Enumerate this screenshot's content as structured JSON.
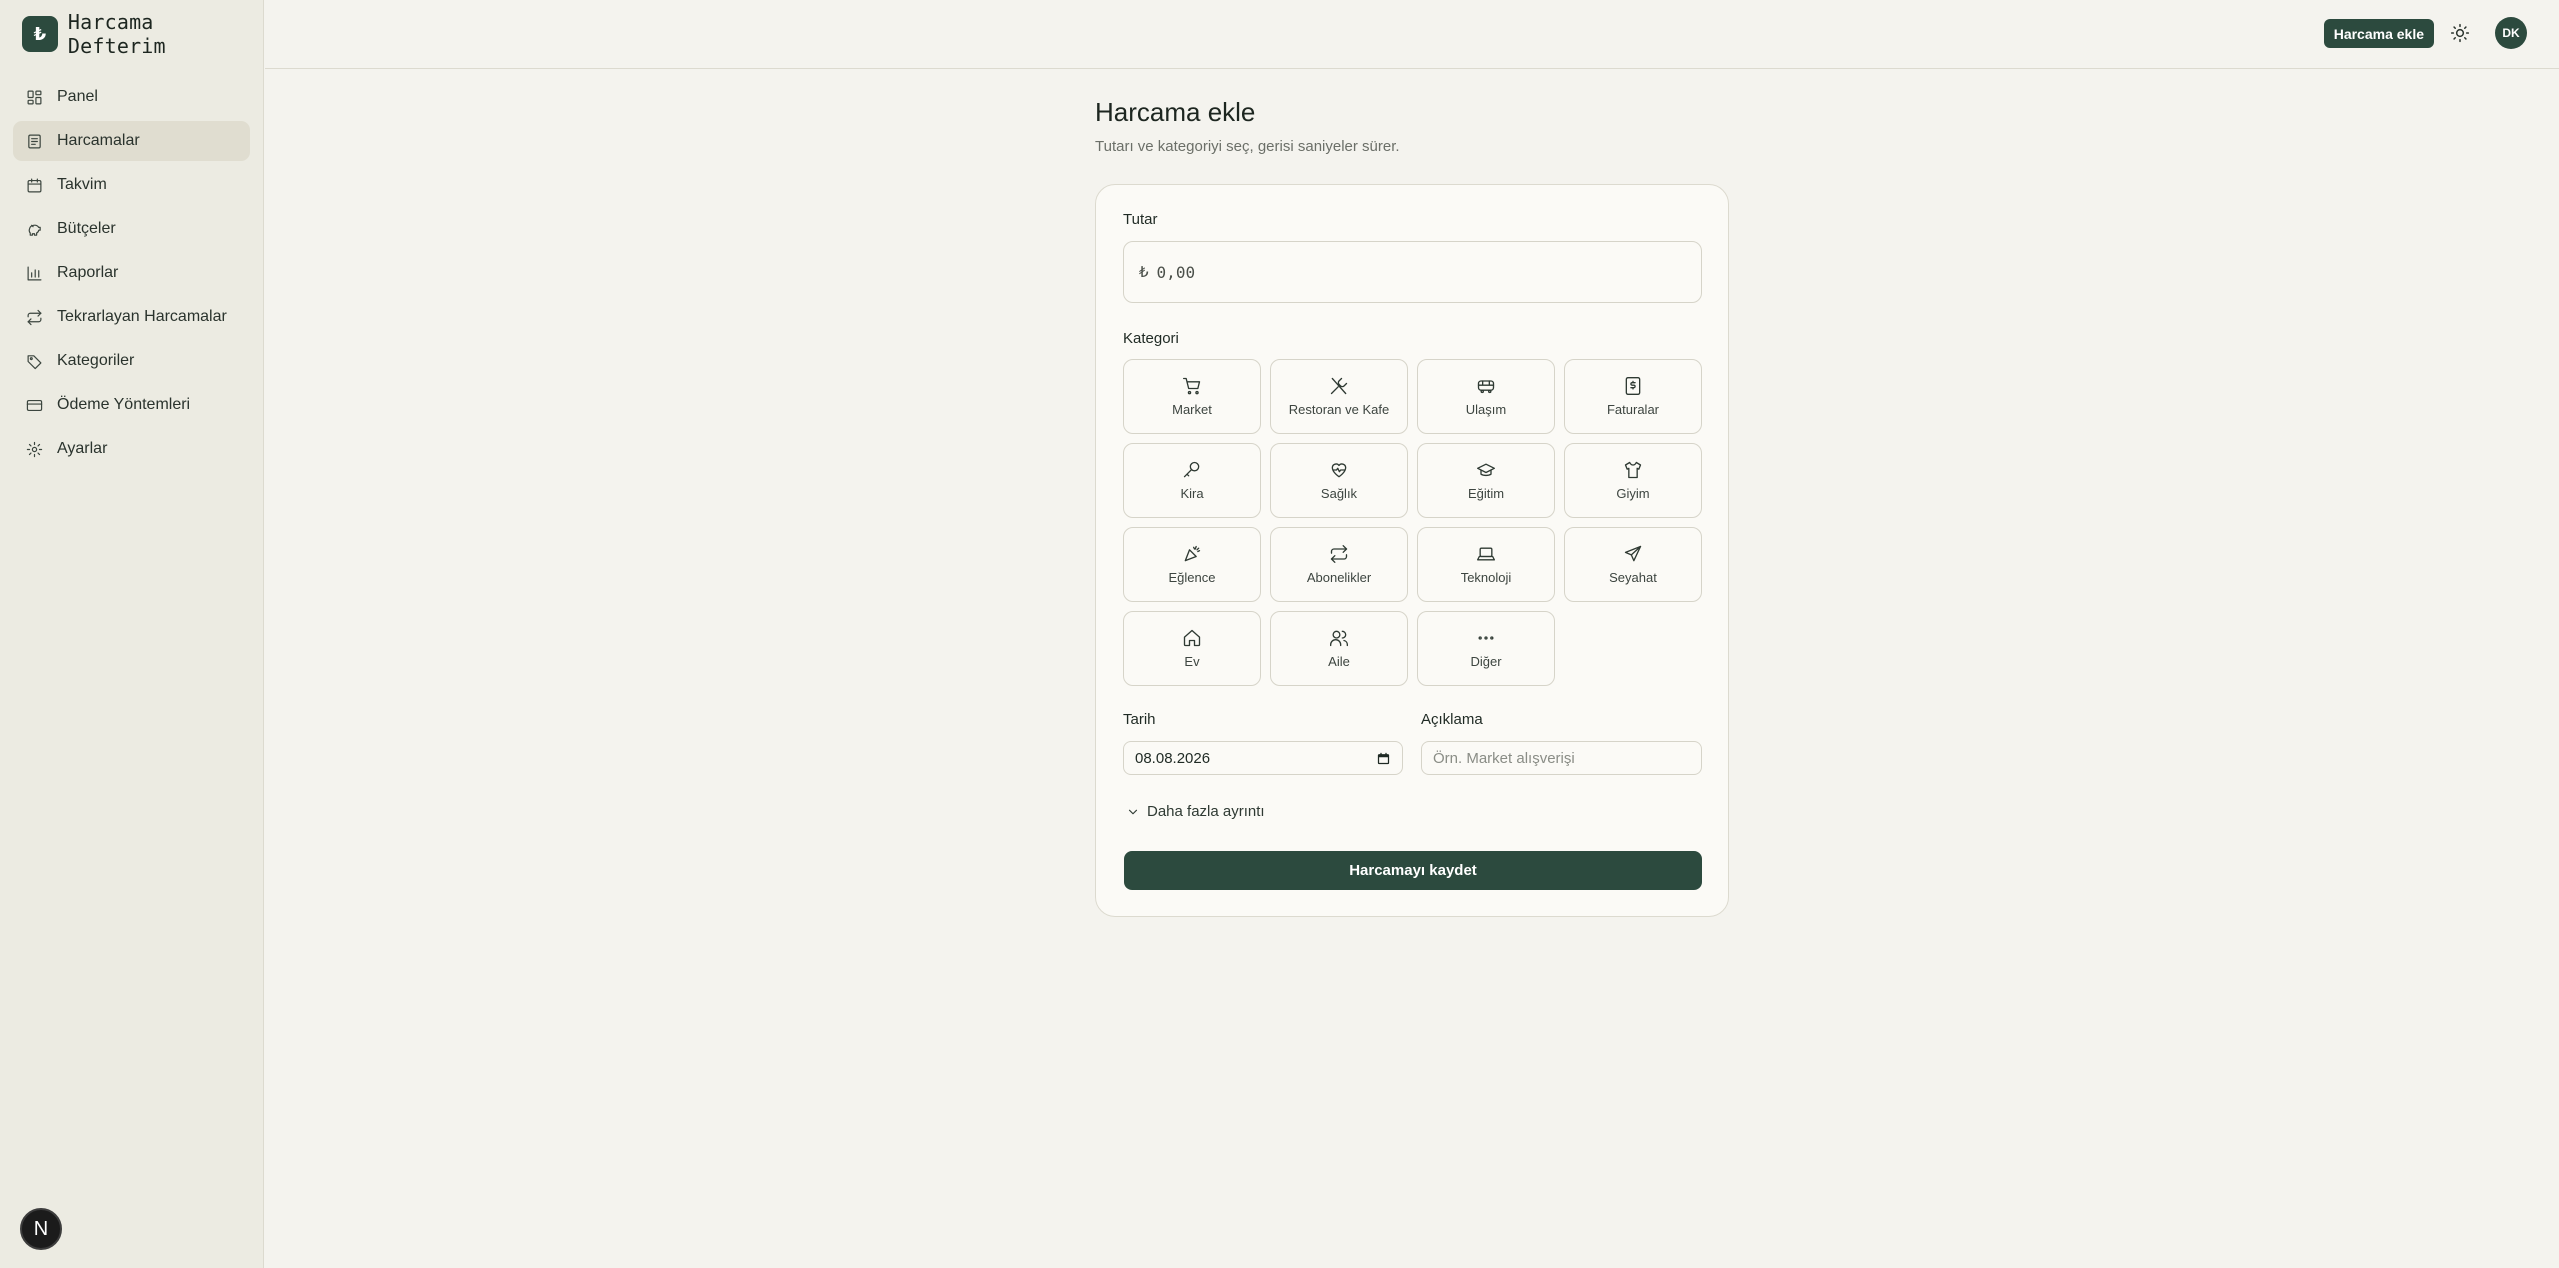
{
  "app": {
    "logo_glyph": "₺",
    "title": "Harcama Defterim"
  },
  "sidebar": {
    "items": [
      {
        "label": "Panel",
        "icon": "dashboard-icon"
      },
      {
        "label": "Harcamalar",
        "icon": "receipt-icon",
        "active": true
      },
      {
        "label": "Takvim",
        "icon": "calendar-icon"
      },
      {
        "label": "Bütçeler",
        "icon": "piggy-bank-icon"
      },
      {
        "label": "Raporlar",
        "icon": "bar-chart-icon"
      },
      {
        "label": "Tekrarlayan Harcamalar",
        "icon": "repeat-icon"
      },
      {
        "label": "Kategoriler",
        "icon": "tags-icon"
      },
      {
        "label": "Ödeme Yöntemleri",
        "icon": "credit-card-icon"
      },
      {
        "label": "Ayarlar",
        "icon": "gear-icon"
      }
    ],
    "footer_badge": "N"
  },
  "topbar": {
    "add_label": "Harcama ekle",
    "theme_icon": "sun-icon",
    "avatar_initials": "DK"
  },
  "page": {
    "title": "Harcama ekle",
    "subtitle": "Tutarı ve kategoriyi seç, gerisi saniyeler sürer."
  },
  "form": {
    "amount_label": "Tutar",
    "currency_symbol": "₺",
    "amount_placeholder": "0,00",
    "category_label": "Kategori",
    "categories": [
      {
        "label": "Market",
        "icon": "shopping-cart-icon"
      },
      {
        "label": "Restoran ve Kafe",
        "icon": "utensils-icon"
      },
      {
        "label": "Ulaşım",
        "icon": "bus-icon"
      },
      {
        "label": "Faturalar",
        "icon": "bill-icon"
      },
      {
        "label": "Kira",
        "icon": "key-icon"
      },
      {
        "label": "Sağlık",
        "icon": "heart-pulse-icon"
      },
      {
        "label": "Eğitim",
        "icon": "graduation-cap-icon"
      },
      {
        "label": "Giyim",
        "icon": "shirt-icon"
      },
      {
        "label": "Eğlence",
        "icon": "party-popper-icon"
      },
      {
        "label": "Abonelikler",
        "icon": "repeat-icon"
      },
      {
        "label": "Teknoloji",
        "icon": "laptop-icon"
      },
      {
        "label": "Seyahat",
        "icon": "plane-icon"
      },
      {
        "label": "Ev",
        "icon": "home-icon"
      },
      {
        "label": "Aile",
        "icon": "users-icon"
      },
      {
        "label": "Diğer",
        "icon": "ellipsis-icon"
      }
    ],
    "date_label": "Tarih",
    "date_value": "08.08.2026",
    "description_label": "Açıklama",
    "description_placeholder": "Örn. Market alışverişi",
    "more_details_label": "Daha fazla ayrıntı",
    "save_label": "Harcamayı kaydet"
  },
  "colors": {
    "brand": "#2c4a3e",
    "background": "#f4f3ee",
    "sidebar": "#ecebe2"
  }
}
